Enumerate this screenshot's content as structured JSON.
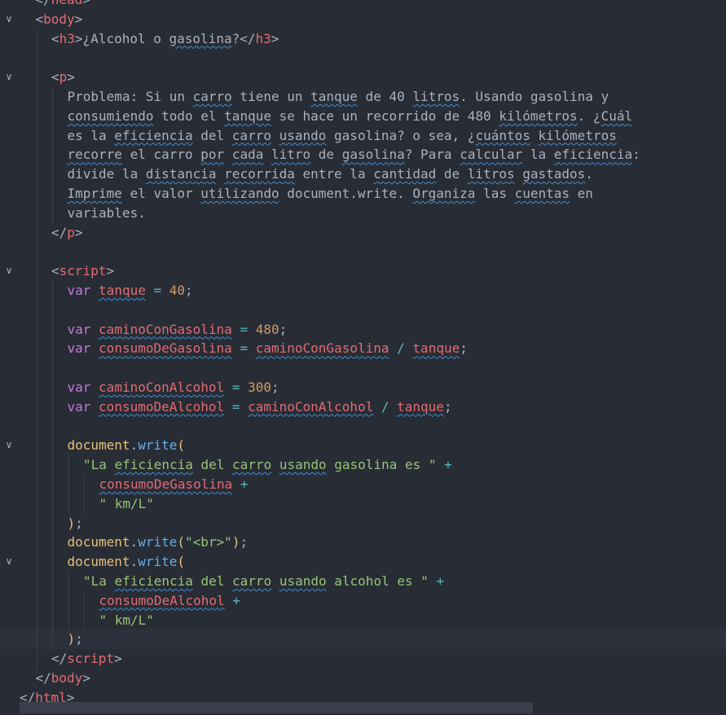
{
  "editor": {
    "language": "html",
    "theme": {
      "background": "#282c34",
      "tag": "#e06c75",
      "keyword": "#c678dd",
      "variable": "#e06c75",
      "number": "#d19a66",
      "string": "#98c379",
      "function": "#61afef",
      "object": "#e5c07b",
      "operator": "#56b6c2",
      "spell_squiggle": "#3d8fd6"
    },
    "lines": [
      {
        "indent": 1,
        "fold": false,
        "tokens": [
          [
            "punc",
            "</"
          ],
          [
            "tag",
            "head"
          ],
          [
            "punc",
            ">"
          ]
        ]
      },
      {
        "indent": 1,
        "fold": true,
        "tokens": [
          [
            "punc",
            "<"
          ],
          [
            "tag",
            "body"
          ],
          [
            "punc",
            ">"
          ]
        ]
      },
      {
        "indent": 2,
        "fold": false,
        "tokens": [
          [
            "punc",
            "<"
          ],
          [
            "tag",
            "h3"
          ],
          [
            "punc",
            ">"
          ],
          [
            "text",
            "¿Alcohol o "
          ],
          [
            "text",
            "gasolina",
            "sq"
          ],
          [
            "text",
            "?"
          ],
          [
            "punc",
            "</"
          ],
          [
            "tag",
            "h3"
          ],
          [
            "punc",
            ">"
          ]
        ]
      },
      {
        "indent": 2,
        "fold": false,
        "tokens": []
      },
      {
        "indent": 2,
        "fold": true,
        "tokens": [
          [
            "punc",
            "<"
          ],
          [
            "tag",
            "p"
          ],
          [
            "punc",
            ">"
          ]
        ]
      },
      {
        "indent": 3,
        "fold": false,
        "tokens": [
          [
            "text",
            "Problema: Si un "
          ],
          [
            "text",
            "carro",
            "sq"
          ],
          [
            "text",
            " tiene un "
          ],
          [
            "text",
            "tanque",
            "sq"
          ],
          [
            "text",
            " de 40 "
          ],
          [
            "text",
            "litros",
            "sq"
          ],
          [
            "text",
            ". Usando gasolina y"
          ]
        ]
      },
      {
        "indent": 3,
        "fold": false,
        "tokens": [
          [
            "text",
            "consumiendo",
            "sq"
          ],
          [
            "text",
            " todo el "
          ],
          [
            "text",
            "tanque",
            "sq"
          ],
          [
            "text",
            " se hace un recorrido de 480 "
          ],
          [
            "text",
            "kilómetros",
            "sq"
          ],
          [
            "text",
            ". ¿"
          ],
          [
            "text",
            "Cuál",
            "sq"
          ]
        ]
      },
      {
        "indent": 3,
        "fold": false,
        "tokens": [
          [
            "text",
            "es la "
          ],
          [
            "text",
            "eficiencia",
            "sq"
          ],
          [
            "text",
            " del "
          ],
          [
            "text",
            "carro",
            "sq"
          ],
          [
            "text",
            " "
          ],
          [
            "text",
            "usando",
            "sq"
          ],
          [
            "text",
            " gasolina? o sea, ¿"
          ],
          [
            "text",
            "cuántos",
            "sq"
          ],
          [
            "text",
            " "
          ],
          [
            "text",
            "kilómetros",
            "sq"
          ]
        ]
      },
      {
        "indent": 3,
        "fold": false,
        "tokens": [
          [
            "text",
            "recorre",
            "sq"
          ],
          [
            "text",
            " el carro "
          ],
          [
            "text",
            "por",
            "sq"
          ],
          [
            "text",
            " "
          ],
          [
            "text",
            "cada",
            "sq"
          ],
          [
            "text",
            " "
          ],
          [
            "text",
            "litro",
            "sq"
          ],
          [
            "text",
            " de "
          ],
          [
            "text",
            "gasolina",
            "sq"
          ],
          [
            "text",
            "? Para "
          ],
          [
            "text",
            "calcular",
            "sq"
          ],
          [
            "text",
            " la "
          ],
          [
            "text",
            "eficiencia",
            "sq"
          ],
          [
            "text",
            ":"
          ]
        ]
      },
      {
        "indent": 3,
        "fold": false,
        "tokens": [
          [
            "text",
            "divide la "
          ],
          [
            "text",
            "distancia",
            "sq"
          ],
          [
            "text",
            " "
          ],
          [
            "text",
            "recorrida",
            "sq"
          ],
          [
            "text",
            " entre la "
          ],
          [
            "text",
            "cantidad",
            "sq"
          ],
          [
            "text",
            " de "
          ],
          [
            "text",
            "litros",
            "sq"
          ],
          [
            "text",
            " "
          ],
          [
            "text",
            "gastados",
            "sq"
          ],
          [
            "text",
            "."
          ]
        ]
      },
      {
        "indent": 3,
        "fold": false,
        "tokens": [
          [
            "text",
            "Imprime",
            "sq"
          ],
          [
            "text",
            " el valor "
          ],
          [
            "text",
            "utilizando",
            "sq"
          ],
          [
            "text",
            " document.write. "
          ],
          [
            "text",
            "Organiza",
            "sq"
          ],
          [
            "text",
            " las "
          ],
          [
            "text",
            "cuentas",
            "sq"
          ],
          [
            "text",
            " en"
          ]
        ]
      },
      {
        "indent": 3,
        "fold": false,
        "tokens": [
          [
            "text",
            "variables."
          ]
        ]
      },
      {
        "indent": 2,
        "fold": false,
        "tokens": [
          [
            "punc",
            "</"
          ],
          [
            "tag",
            "p"
          ],
          [
            "punc",
            ">"
          ]
        ]
      },
      {
        "indent": 2,
        "fold": false,
        "tokens": []
      },
      {
        "indent": 2,
        "fold": true,
        "tokens": [
          [
            "punc",
            "<"
          ],
          [
            "tag",
            "script"
          ],
          [
            "punc",
            ">"
          ]
        ]
      },
      {
        "indent": 3,
        "fold": false,
        "tokens": [
          [
            "kw",
            "var"
          ],
          [
            "text",
            " "
          ],
          [
            "var",
            "tanque",
            "sq"
          ],
          [
            "text",
            " "
          ],
          [
            "op",
            "="
          ],
          [
            "text",
            " "
          ],
          [
            "num",
            "40"
          ],
          [
            "punc",
            ";"
          ]
        ]
      },
      {
        "indent": 3,
        "fold": false,
        "tokens": []
      },
      {
        "indent": 3,
        "fold": false,
        "tokens": [
          [
            "kw",
            "var"
          ],
          [
            "text",
            " "
          ],
          [
            "var",
            "caminoConGasolina",
            "sq"
          ],
          [
            "text",
            " "
          ],
          [
            "op",
            "="
          ],
          [
            "text",
            " "
          ],
          [
            "num",
            "480"
          ],
          [
            "punc",
            ";"
          ]
        ]
      },
      {
        "indent": 3,
        "fold": false,
        "tokens": [
          [
            "kw",
            "var"
          ],
          [
            "text",
            " "
          ],
          [
            "var",
            "consumoDeGasolina",
            "sq"
          ],
          [
            "text",
            " "
          ],
          [
            "op",
            "="
          ],
          [
            "text",
            " "
          ],
          [
            "var",
            "caminoConGasolina",
            "sq"
          ],
          [
            "text",
            " "
          ],
          [
            "op",
            "/"
          ],
          [
            "text",
            " "
          ],
          [
            "var",
            "tanque",
            "sq"
          ],
          [
            "punc",
            ";"
          ]
        ]
      },
      {
        "indent": 3,
        "fold": false,
        "tokens": []
      },
      {
        "indent": 3,
        "fold": false,
        "tokens": [
          [
            "kw",
            "var"
          ],
          [
            "text",
            " "
          ],
          [
            "var",
            "caminoConAlcohol",
            "sq"
          ],
          [
            "text",
            " "
          ],
          [
            "op",
            "="
          ],
          [
            "text",
            " "
          ],
          [
            "num",
            "300"
          ],
          [
            "punc",
            ";"
          ]
        ]
      },
      {
        "indent": 3,
        "fold": false,
        "tokens": [
          [
            "kw",
            "var"
          ],
          [
            "text",
            " "
          ],
          [
            "var",
            "consumoDeAlcohol",
            "sq"
          ],
          [
            "text",
            " "
          ],
          [
            "op",
            "="
          ],
          [
            "text",
            " "
          ],
          [
            "var",
            "caminoConAlcohol",
            "sq"
          ],
          [
            "text",
            " "
          ],
          [
            "op",
            "/"
          ],
          [
            "text",
            " "
          ],
          [
            "var",
            "tanque",
            "sq"
          ],
          [
            "punc",
            ";"
          ]
        ]
      },
      {
        "indent": 3,
        "fold": false,
        "tokens": []
      },
      {
        "indent": 3,
        "fold": true,
        "tokens": [
          [
            "obj",
            "document"
          ],
          [
            "punc",
            "."
          ],
          [
            "fn",
            "write"
          ],
          [
            "obj",
            "("
          ]
        ]
      },
      {
        "indent": 4,
        "fold": false,
        "tokens": [
          [
            "str",
            "\"La "
          ],
          [
            "str",
            "eficiencia",
            "sq"
          ],
          [
            "str",
            " del "
          ],
          [
            "str",
            "carro",
            "sq"
          ],
          [
            "str",
            " "
          ],
          [
            "str",
            "usando",
            "sq"
          ],
          [
            "str",
            " gasolina es \""
          ],
          [
            "text",
            " "
          ],
          [
            "op",
            "+"
          ]
        ]
      },
      {
        "indent": 5,
        "fold": false,
        "tokens": [
          [
            "var",
            "consumoDeGasolina",
            "sq"
          ],
          [
            "text",
            " "
          ],
          [
            "op",
            "+"
          ]
        ]
      },
      {
        "indent": 5,
        "fold": false,
        "tokens": [
          [
            "str",
            "\" km/L\""
          ]
        ]
      },
      {
        "indent": 3,
        "fold": false,
        "tokens": [
          [
            "obj",
            ")"
          ],
          [
            "punc",
            ";"
          ]
        ]
      },
      {
        "indent": 3,
        "fold": false,
        "tokens": [
          [
            "obj",
            "document"
          ],
          [
            "punc",
            "."
          ],
          [
            "fn",
            "write"
          ],
          [
            "obj",
            "("
          ],
          [
            "str",
            "\"<br>\""
          ],
          [
            "obj",
            ")"
          ],
          [
            "punc",
            ";"
          ]
        ]
      },
      {
        "indent": 3,
        "fold": true,
        "tokens": [
          [
            "obj",
            "document"
          ],
          [
            "punc",
            "."
          ],
          [
            "fn",
            "write"
          ],
          [
            "obj",
            "("
          ]
        ]
      },
      {
        "indent": 4,
        "fold": false,
        "tokens": [
          [
            "str",
            "\"La "
          ],
          [
            "str",
            "eficiencia",
            "sq"
          ],
          [
            "str",
            " del "
          ],
          [
            "str",
            "carro",
            "sq"
          ],
          [
            "str",
            " "
          ],
          [
            "str",
            "usando",
            "sq"
          ],
          [
            "str",
            " alcohol es \""
          ],
          [
            "text",
            " "
          ],
          [
            "op",
            "+"
          ]
        ]
      },
      {
        "indent": 5,
        "fold": false,
        "tokens": [
          [
            "var",
            "consumoDeAlcohol",
            "sq"
          ],
          [
            "text",
            " "
          ],
          [
            "op",
            "+"
          ]
        ]
      },
      {
        "indent": 5,
        "fold": false,
        "tokens": [
          [
            "str",
            "\" km/L\""
          ]
        ]
      },
      {
        "indent": 3,
        "fold": false,
        "tokens": [
          [
            "obj",
            ")"
          ],
          [
            "punc",
            ";"
          ]
        ],
        "active": true
      },
      {
        "indent": 2,
        "fold": false,
        "tokens": [
          [
            "punc",
            "</"
          ],
          [
            "tag",
            "script"
          ],
          [
            "punc",
            ">"
          ]
        ]
      },
      {
        "indent": 1,
        "fold": false,
        "tokens": [
          [
            "punc",
            "</"
          ],
          [
            "tag",
            "body"
          ],
          [
            "punc",
            ">"
          ]
        ]
      },
      {
        "indent": 0,
        "fold": false,
        "tokens": [
          [
            "punc",
            "</"
          ],
          [
            "tag",
            "html"
          ],
          [
            "punc",
            ">"
          ]
        ]
      }
    ]
  }
}
